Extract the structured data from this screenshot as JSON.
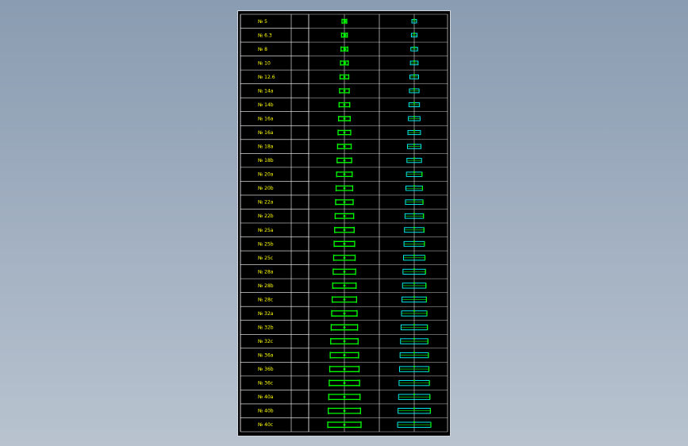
{
  "drawing": {
    "background": "#000000",
    "grid_color": "#ffffff",
    "label_color": "#ffff00",
    "section_color": "#00ff00",
    "plan_color": "#00ffff",
    "rows": [
      "№ 5",
      "№ 6.3",
      "№ 8",
      "№ 10",
      "№ 12.6",
      "№ 14a",
      "№ 14b",
      "№ 16a",
      "№ 16a",
      "№ 18a",
      "№ 18b",
      "№ 20a",
      "№ 20b",
      "№ 22a",
      "№ 22b",
      "№ 25a",
      "№ 25b",
      "№ 25c",
      "№ 28a",
      "№ 28b",
      "№ 28c",
      "№ 32a",
      "№ 32b",
      "№ 32c",
      "№ 36a",
      "№ 36b",
      "№ 36c",
      "№ 40a",
      "№ 40b",
      "№ 40c"
    ]
  }
}
